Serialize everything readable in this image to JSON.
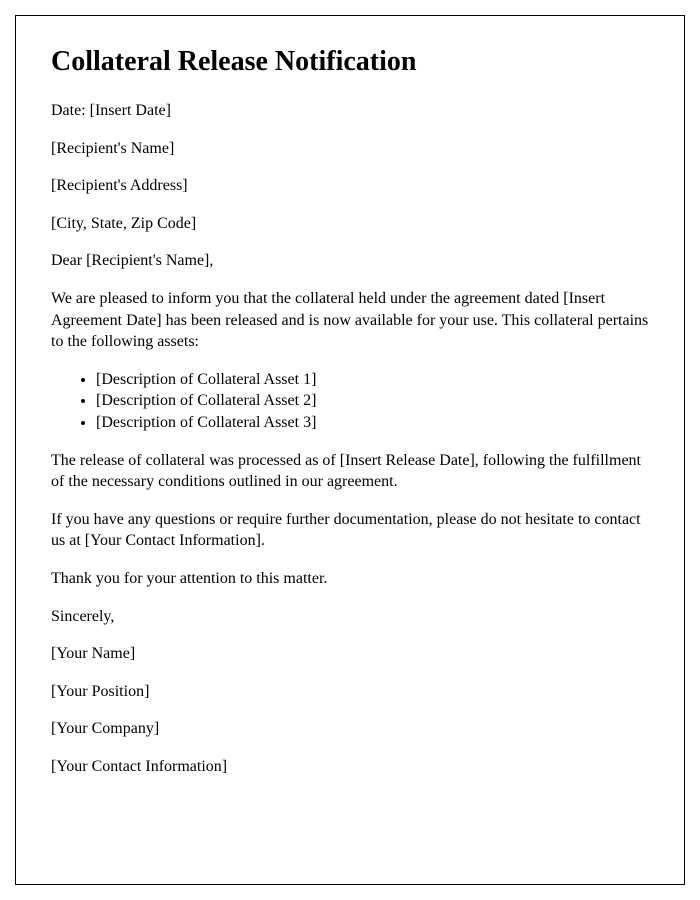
{
  "title": "Collateral Release Notification",
  "date_line": "Date: [Insert Date]",
  "recipient_name": "[Recipient's Name]",
  "recipient_address": "[Recipient's Address]",
  "recipient_city_state_zip": "[City, State, Zip Code]",
  "salutation": "Dear [Recipient's Name],",
  "paragraph_1": "We are pleased to inform you that the collateral held under the agreement dated [Insert Agreement Date] has been released and is now available for your use. This collateral pertains to the following assets:",
  "assets": [
    "[Description of Collateral Asset 1]",
    "[Description of Collateral Asset 2]",
    "[Description of Collateral Asset 3]"
  ],
  "paragraph_2": "The release of collateral was processed as of [Insert Release Date], following the fulfillment of the necessary conditions outlined in our agreement.",
  "paragraph_3": "If you have any questions or require further documentation, please do not hesitate to contact us at [Your Contact Information].",
  "paragraph_4": "Thank you for your attention to this matter.",
  "closing": "Sincerely,",
  "sender_name": "[Your Name]",
  "sender_position": "[Your Position]",
  "sender_company": "[Your Company]",
  "sender_contact": "[Your Contact Information]"
}
